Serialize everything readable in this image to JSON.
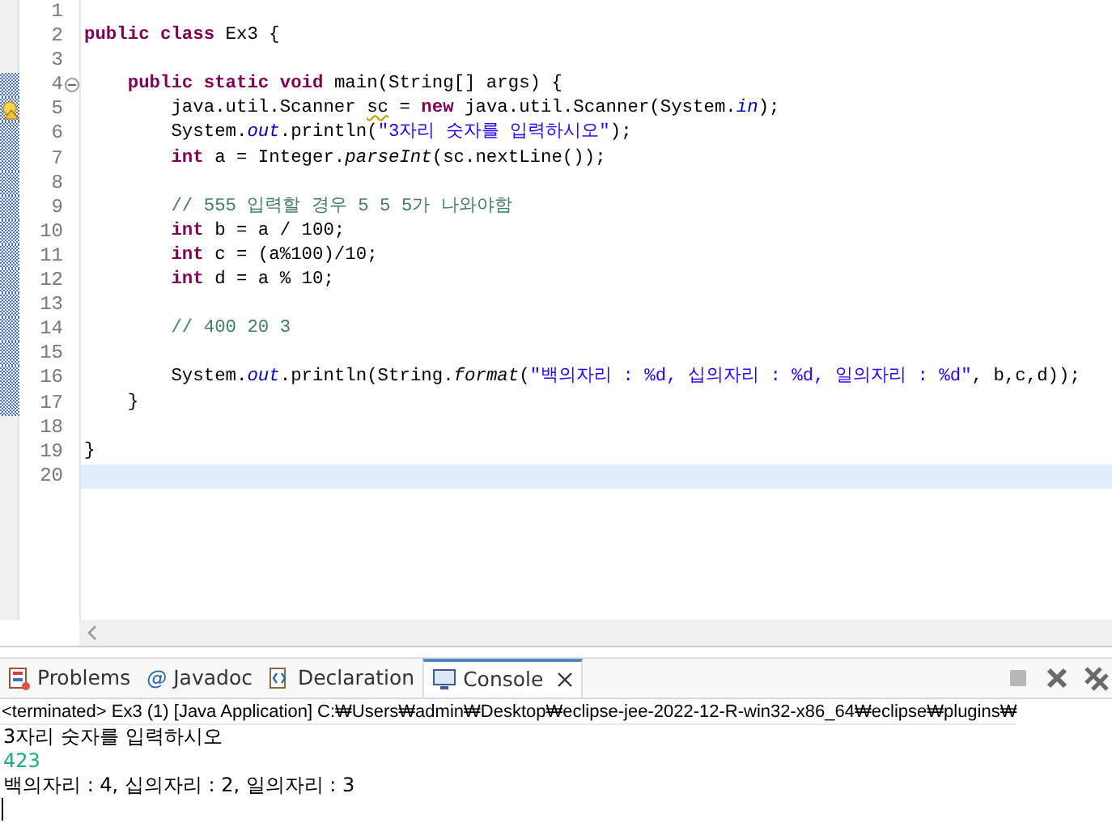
{
  "editor": {
    "lines": [
      {
        "number": "1",
        "current": false,
        "range": false,
        "collapsible": false,
        "warning": false
      },
      {
        "number": "2",
        "current": false,
        "range": false,
        "collapsible": false,
        "warning": false,
        "tokens": [
          {
            "kind": "kw",
            "text": "public "
          },
          {
            "kind": "kw",
            "text": "class "
          },
          {
            "kind": "plain",
            "text": "Ex3 {"
          }
        ]
      },
      {
        "number": "3",
        "current": false,
        "range": false,
        "collapsible": false,
        "warning": false
      },
      {
        "number": "4",
        "current": false,
        "range": true,
        "collapsible": true,
        "warning": false,
        "tokens": [
          {
            "kind": "kw",
            "text": "    public "
          },
          {
            "kind": "kw",
            "text": "static "
          },
          {
            "kind": "kw",
            "text": "void "
          },
          {
            "kind": "plain",
            "text": "main(String[] args) {"
          }
        ]
      },
      {
        "number": "5",
        "current": false,
        "range": true,
        "collapsible": false,
        "warning": true,
        "tokens": [
          {
            "kind": "plain",
            "text": "        java.util.Scanner "
          },
          {
            "kind": "warn",
            "text": "sc"
          },
          {
            "kind": "plain",
            "text": " = "
          },
          {
            "kind": "kw",
            "text": "new"
          },
          {
            "kind": "plain",
            "text": " java.util.Scanner(System."
          },
          {
            "kind": "field",
            "text": "in"
          },
          {
            "kind": "plain",
            "text": ");"
          }
        ]
      },
      {
        "number": "6",
        "current": false,
        "range": true,
        "collapsible": false,
        "warning": false,
        "tokens": [
          {
            "kind": "plain",
            "text": "        System."
          },
          {
            "kind": "field",
            "text": "out"
          },
          {
            "kind": "plain",
            "text": ".println("
          },
          {
            "kind": "str",
            "text": "\"3자리 숫자를 입력하시오\""
          },
          {
            "kind": "plain",
            "text": ");"
          }
        ]
      },
      {
        "number": "7",
        "current": false,
        "range": true,
        "collapsible": false,
        "warning": false,
        "tokens": [
          {
            "kind": "kw",
            "text": "        int"
          },
          {
            "kind": "plain",
            "text": " a = Integer."
          },
          {
            "kind": "static",
            "text": "parseInt"
          },
          {
            "kind": "plain",
            "text": "(sc.nextLine());"
          }
        ]
      },
      {
        "number": "8",
        "current": false,
        "range": true,
        "collapsible": false,
        "warning": false
      },
      {
        "number": "9",
        "current": false,
        "range": true,
        "collapsible": false,
        "warning": false,
        "tokens": [
          {
            "kind": "comment",
            "text": "        // 555 입력할 경우 5 5 5가 나와야함"
          }
        ]
      },
      {
        "number": "10",
        "current": false,
        "range": true,
        "collapsible": false,
        "warning": false,
        "tokens": [
          {
            "kind": "kw",
            "text": "        int"
          },
          {
            "kind": "plain",
            "text": " b = a / 100;"
          }
        ]
      },
      {
        "number": "11",
        "current": false,
        "range": true,
        "collapsible": false,
        "warning": false,
        "tokens": [
          {
            "kind": "kw",
            "text": "        int"
          },
          {
            "kind": "plain",
            "text": " c = (a%100)/10;"
          }
        ]
      },
      {
        "number": "12",
        "current": false,
        "range": true,
        "collapsible": false,
        "warning": false,
        "tokens": [
          {
            "kind": "kw",
            "text": "        int"
          },
          {
            "kind": "plain",
            "text": " d = a % 10;"
          }
        ]
      },
      {
        "number": "13",
        "current": false,
        "range": true,
        "collapsible": false,
        "warning": false
      },
      {
        "number": "14",
        "current": false,
        "range": true,
        "collapsible": false,
        "warning": false,
        "tokens": [
          {
            "kind": "comment",
            "text": "        // 400 20 3"
          }
        ]
      },
      {
        "number": "15",
        "current": false,
        "range": true,
        "collapsible": false,
        "warning": false
      },
      {
        "number": "16",
        "current": false,
        "range": true,
        "collapsible": false,
        "warning": false,
        "tokens": [
          {
            "kind": "plain",
            "text": "        System."
          },
          {
            "kind": "field",
            "text": "out"
          },
          {
            "kind": "plain",
            "text": ".println(String."
          },
          {
            "kind": "static",
            "text": "format"
          },
          {
            "kind": "plain",
            "text": "("
          },
          {
            "kind": "str",
            "text": "\"백의자리 : %d, 십의자리 : %d, 일의자리 : %d\""
          },
          {
            "kind": "plain",
            "text": ", b,c,d));"
          }
        ]
      },
      {
        "number": "17",
        "current": false,
        "range": true,
        "collapsible": false,
        "warning": false,
        "tokens": [
          {
            "kind": "plain",
            "text": "    }"
          }
        ]
      },
      {
        "number": "18",
        "current": false,
        "range": false,
        "collapsible": false,
        "warning": false
      },
      {
        "number": "19",
        "current": false,
        "range": false,
        "collapsible": false,
        "warning": false,
        "tokens": [
          {
            "kind": "plain",
            "text": "}"
          }
        ]
      },
      {
        "number": "20",
        "current": true,
        "range": false,
        "collapsible": false,
        "warning": false
      }
    ]
  },
  "panel": {
    "tabs": [
      {
        "label": "Problems",
        "selected": false
      },
      {
        "glyph": "@",
        "label": "Javadoc",
        "selected": false
      },
      {
        "label": "Declaration",
        "selected": false
      },
      {
        "label": "Console",
        "selected": true
      }
    ],
    "toolbar": [
      {
        "kind": "stop",
        "disabled": true
      },
      {
        "kind": "remove",
        "disabled": false
      },
      {
        "kind": "remove-all",
        "disabled": false
      }
    ],
    "console_header": "<terminated> Ex3 (1) [Java Application] C:₩Users₩admin₩Desktop₩eclipse-jee-2022-12-R-win32-x86_64₩eclipse₩plugins₩",
    "output": [
      {
        "kind": "out",
        "text": "3자리 숫자를 입력하시오"
      },
      {
        "kind": "in",
        "text": "423"
      },
      {
        "kind": "out",
        "text": "백의자리 : 4, 십의자리 : 2, 일의자리 : 3"
      }
    ]
  }
}
